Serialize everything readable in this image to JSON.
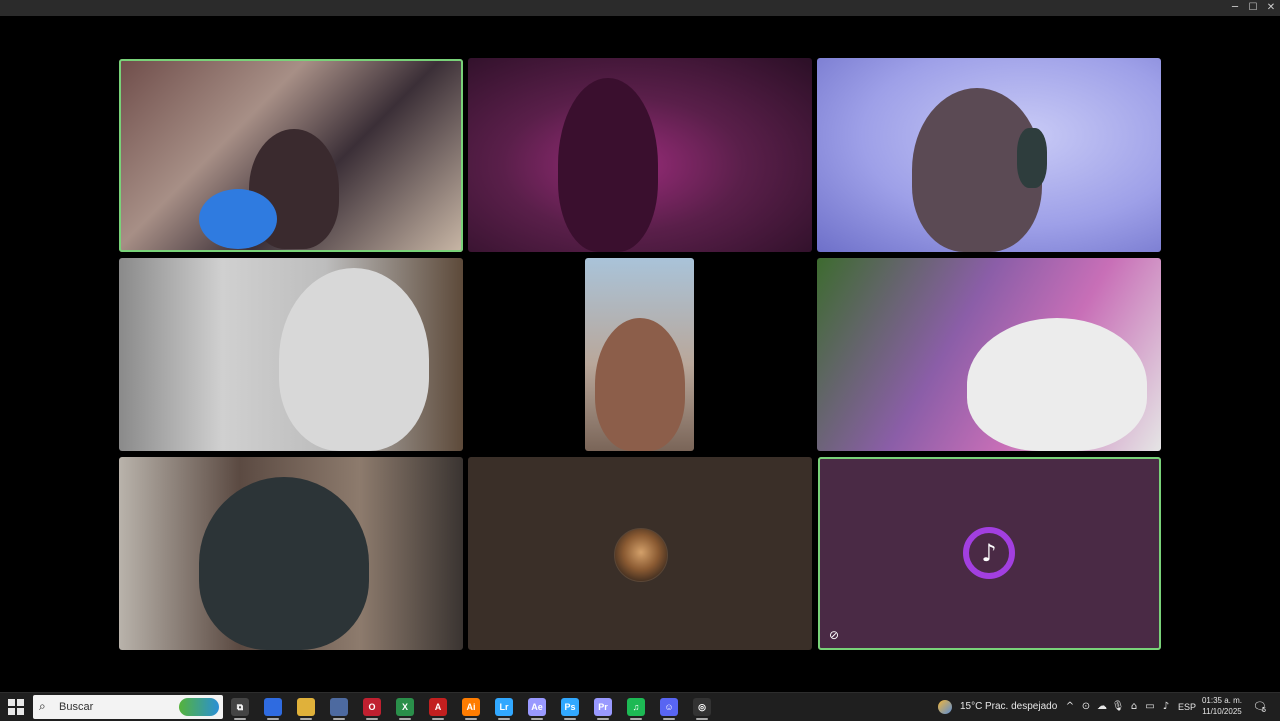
{
  "window": {
    "controls": {
      "minimize": "─",
      "maximize": "☐",
      "close": "✕"
    }
  },
  "participants": [
    {
      "id": 1,
      "speaking": true
    },
    {
      "id": 2
    },
    {
      "id": 3
    },
    {
      "id": 4
    },
    {
      "id": 5
    },
    {
      "id": 6
    },
    {
      "id": 7
    },
    {
      "id": 8,
      "camera": "off",
      "avatar": "warrior-avatar"
    },
    {
      "id": 9,
      "camera": "off",
      "avatar": "music-avatar",
      "muted": true
    }
  ],
  "taskbar": {
    "search_placeholder": "Buscar",
    "apps": [
      {
        "name": "task-view",
        "glyph": "⧉"
      },
      {
        "name": "copilot",
        "glyph": ""
      },
      {
        "name": "file-explorer",
        "glyph": ""
      },
      {
        "name": "store",
        "glyph": ""
      },
      {
        "name": "opera",
        "glyph": "O"
      },
      {
        "name": "excel-like",
        "glyph": "X"
      },
      {
        "name": "acrobat",
        "glyph": "A"
      },
      {
        "name": "illustrator",
        "glyph": "Ai"
      },
      {
        "name": "lightroom",
        "glyph": "Lr"
      },
      {
        "name": "after-effects",
        "glyph": "Ae"
      },
      {
        "name": "photoshop",
        "glyph": "Ps"
      },
      {
        "name": "premiere",
        "glyph": "Pr"
      },
      {
        "name": "spotify",
        "glyph": "♫"
      },
      {
        "name": "discord",
        "glyph": "☺"
      },
      {
        "name": "obs",
        "glyph": "◎"
      }
    ],
    "weather": {
      "temp": "15°C",
      "desc": "Prac. despejado"
    },
    "language": "ESP",
    "time": "01:35 a. m.",
    "date": "11/10/2025",
    "notification_count": "5"
  },
  "colors": {
    "speaking_outline": "#79d279",
    "music_ring": "#a23fe0",
    "taskbar_bg": "#1f1f1f"
  }
}
